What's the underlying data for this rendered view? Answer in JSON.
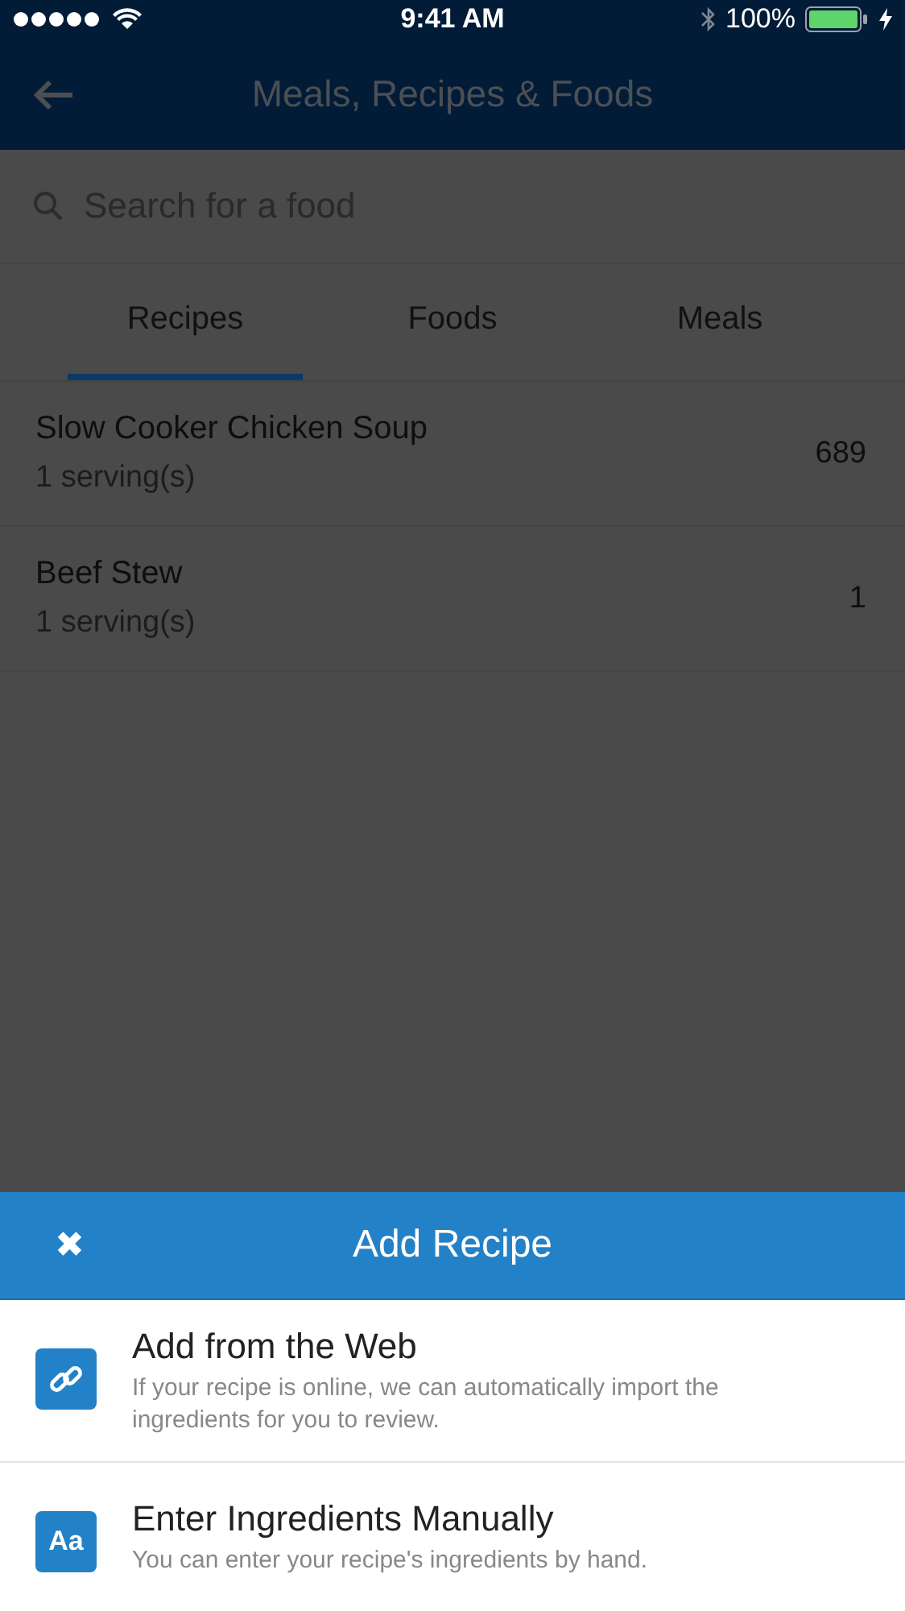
{
  "status_bar": {
    "time": "9:41 AM",
    "battery": "100%"
  },
  "header": {
    "title": "Meals, Recipes & Foods"
  },
  "search": {
    "placeholder": "Search for a food"
  },
  "tabs": [
    {
      "label": "Recipes",
      "selected": true
    },
    {
      "label": "Foods",
      "selected": false
    },
    {
      "label": "Meals",
      "selected": false
    }
  ],
  "recipes": [
    {
      "name": "Slow Cooker Chicken Soup",
      "servings": "1 serving(s)",
      "value": "689"
    },
    {
      "name": "Beef Stew",
      "servings": "1 serving(s)",
      "value": "1"
    }
  ],
  "sheet": {
    "close": "✖",
    "title": "Add Recipe",
    "options": [
      {
        "kind": "link",
        "title": "Add from the Web",
        "description": "If your recipe is online, we can automatically import the ingredients for you to review."
      },
      {
        "kind": "text",
        "icon": "Aa",
        "title": "Enter Ingredients Manually",
        "description": "You can enter your recipe's ingredients by hand."
      }
    ]
  }
}
